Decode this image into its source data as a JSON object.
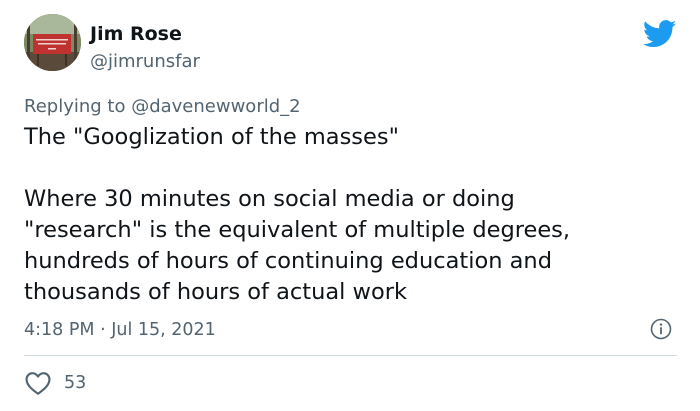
{
  "author": {
    "name": "Jim Rose",
    "handle": "@jimrunsfar",
    "avatar_icon": "avatar-sign-photo"
  },
  "brand": {
    "icon": "twitter-bird-icon",
    "color": "#1d9bf0"
  },
  "reply": {
    "prefix": "Replying to ",
    "mention": "@davenewworld_2"
  },
  "tweet": {
    "paragraph_1": "The \"Googlization of the masses\"",
    "paragraph_2": "Where 30 minutes on social media or doing\n\"research\" is the equivalent of multiple degrees,\nhundreds of hours of continuing education and\nthousands of hours of actual work"
  },
  "meta": {
    "timestamp": "4:18 PM · Jul 15, 2021",
    "info_icon": "info-icon"
  },
  "engagement": {
    "like_icon": "heart-icon",
    "like_count": "53"
  },
  "colors": {
    "text_primary": "#0f1419",
    "text_secondary": "#536471",
    "divider": "#cfd9de"
  }
}
